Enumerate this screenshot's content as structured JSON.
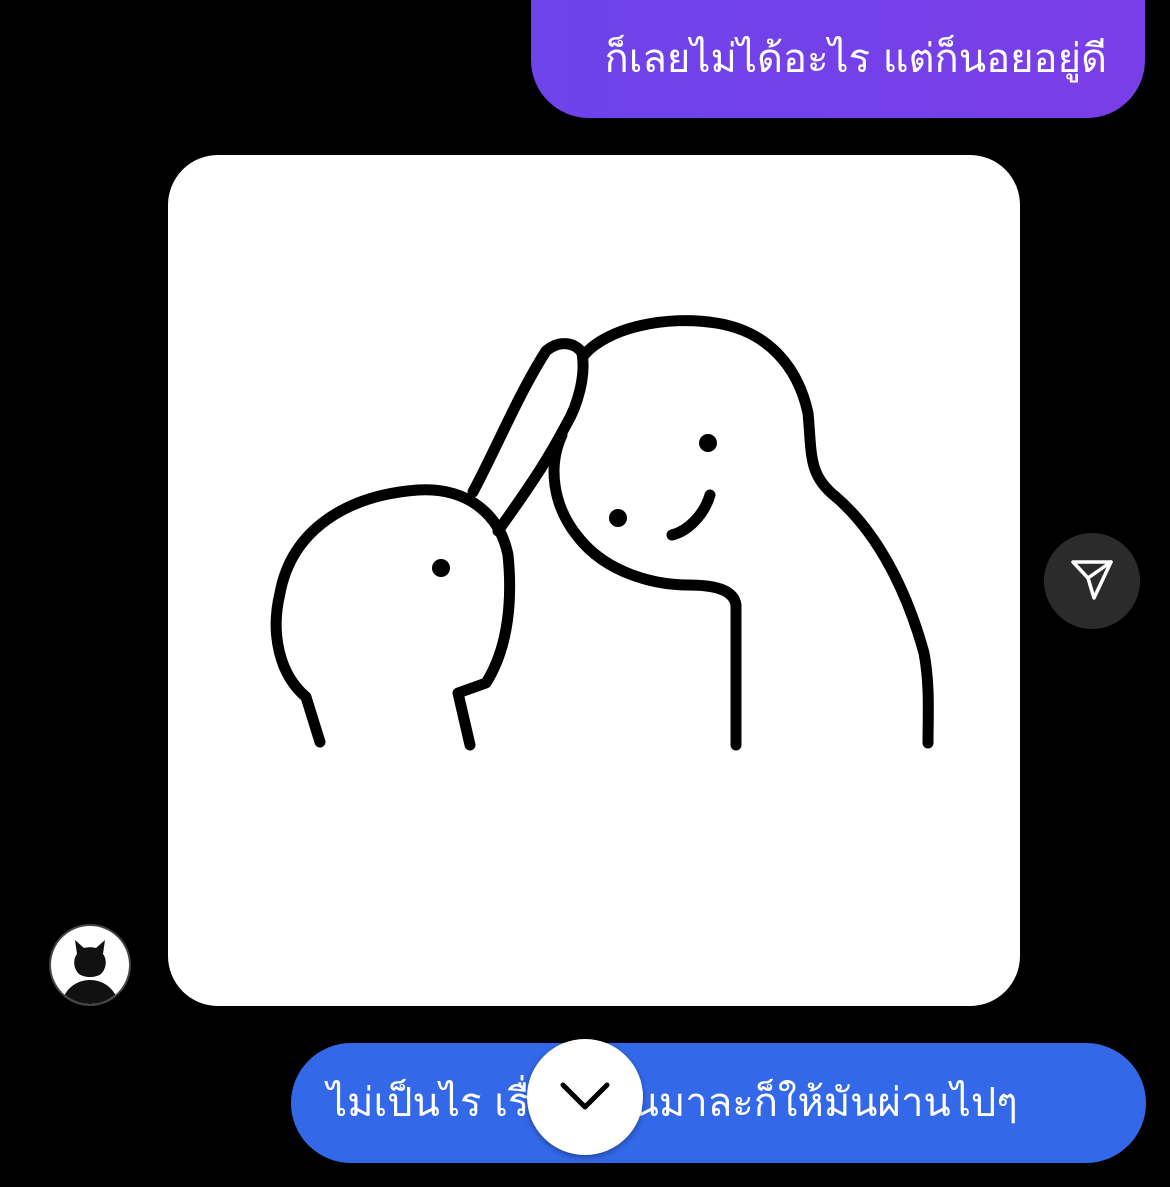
{
  "colors": {
    "background": "#000000",
    "outgoing_top": "#6d43ea",
    "outgoing_top_gradient_end": "#7a3ee8",
    "outgoing_bottom": "#3368e8",
    "share_button_bg": "#2b2b2b",
    "text": "#ffffff"
  },
  "messages": [
    {
      "id": "msg-1",
      "direction": "outgoing",
      "type": "text",
      "text": "ก็เลยไม่ได้อะไร แต่ก็นอยอยู่ดี"
    },
    {
      "id": "msg-2",
      "direction": "incoming",
      "type": "image",
      "image_description_icon": "sticker-head-pat"
    },
    {
      "id": "msg-3",
      "direction": "outgoing",
      "type": "text",
      "text": "ไม่เป็นไร เรื่อง ผ่านมาละก็ให้มันผ่านไปๆ"
    }
  ],
  "controls": {
    "share_icon": "paper-plane-icon",
    "scroll_down_icon": "chevron-down-icon",
    "avatar_icon": "cat-silhouette-icon"
  }
}
